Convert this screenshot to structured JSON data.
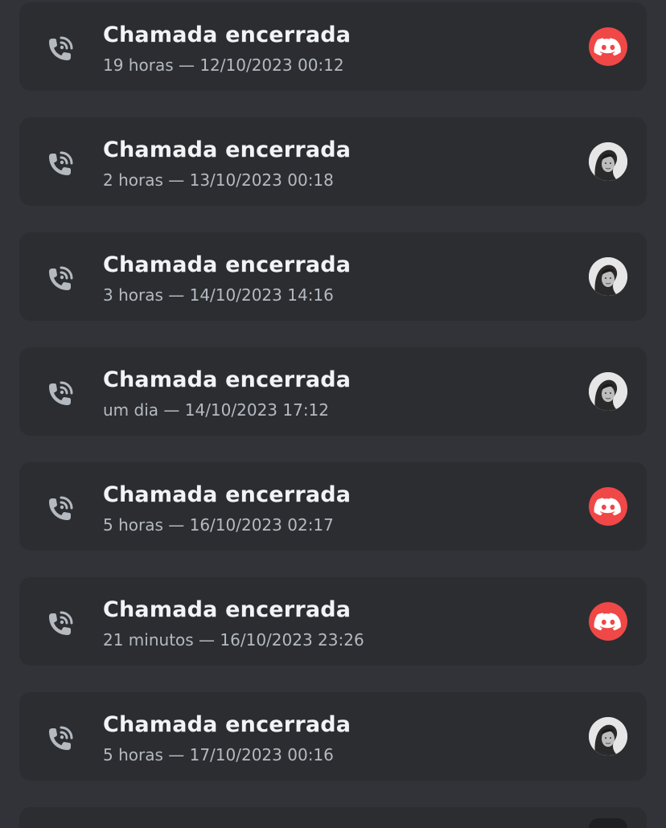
{
  "calls": [
    {
      "title": "Chamada encerrada",
      "subtitle": "19 horas — 12/10/2023 00:12",
      "avatar": "discord-logo-icon"
    },
    {
      "title": "Chamada encerrada",
      "subtitle": "2 horas — 13/10/2023 00:18",
      "avatar": "user-photo-avatar"
    },
    {
      "title": "Chamada encerrada",
      "subtitle": "3 horas — 14/10/2023 14:16",
      "avatar": "user-photo-avatar"
    },
    {
      "title": "Chamada encerrada",
      "subtitle": "um dia — 14/10/2023 17:12",
      "avatar": "user-photo-avatar"
    },
    {
      "title": "Chamada encerrada",
      "subtitle": "5 horas — 16/10/2023 02:17",
      "avatar": "discord-logo-icon"
    },
    {
      "title": "Chamada encerrada",
      "subtitle": "21 minutos — 16/10/2023 23:26",
      "avatar": "discord-logo-icon"
    },
    {
      "title": "Chamada encerrada",
      "subtitle": "5 horas — 17/10/2023 00:16",
      "avatar": "user-photo-avatar"
    }
  ],
  "colors": {
    "background": "#313338",
    "card": "#2b2d31",
    "title": "#f2f3f5",
    "subtitle": "#b5bac1",
    "icon": "#b5bac1",
    "discord_red": "#f04747"
  }
}
